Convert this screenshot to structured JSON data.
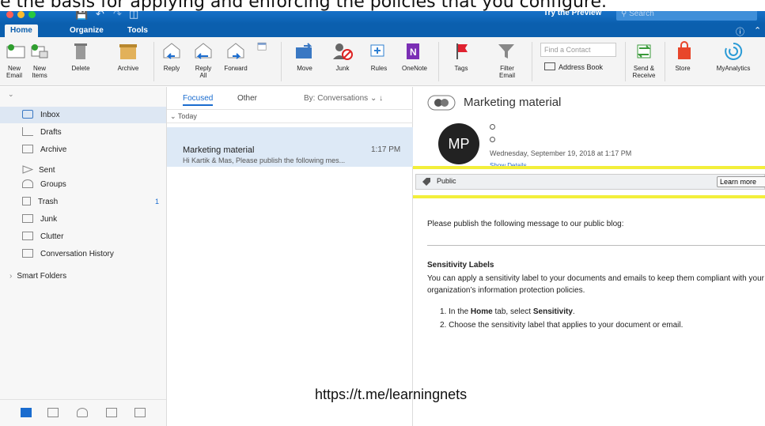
{
  "caption": "e the basis for applying and enforcing the policies that you configure.",
  "titlebar": {
    "try_preview": "Try the Preview",
    "search_placeholder": "Search",
    "help": "?"
  },
  "tabs": [
    "Home",
    "Organize",
    "Tools"
  ],
  "ribbon": {
    "new_email": "New Email",
    "new_items": "New Items",
    "delete": "Delete",
    "archive": "Archive",
    "reply": "Reply",
    "reply_all": "Reply All",
    "forward": "Forward",
    "move": "Move",
    "junk": "Junk",
    "rules": "Rules",
    "onenote": "OneNote",
    "tags": "Tags",
    "filter_email": "Filter Email",
    "find_contact": "Find a Contact",
    "address_book": "Address Book",
    "send_receive": "Send & Receive",
    "store": "Store",
    "myanalytics": "MyAnalytics"
  },
  "sidebar": {
    "folders": [
      {
        "label": "Inbox",
        "icon": "inbox-icon"
      },
      {
        "label": "Drafts",
        "icon": "drafts-icon"
      },
      {
        "label": "Archive",
        "icon": "archive-icon"
      },
      {
        "label": "Sent",
        "icon": "sent-icon"
      },
      {
        "label": "Groups",
        "icon": "groups-icon"
      },
      {
        "label": "Trash",
        "icon": "trash-icon",
        "count": "1"
      },
      {
        "label": "Junk",
        "icon": "junk-icon"
      },
      {
        "label": "Clutter",
        "icon": "folder-icon"
      },
      {
        "label": "Conversation History",
        "icon": "folder-icon"
      }
    ],
    "smart_folders": "Smart Folders"
  },
  "list": {
    "focused": "Focused",
    "other": "Other",
    "sort": "By: Conversations",
    "group": "Today",
    "message": {
      "sender": "Marketing material",
      "time": "1:17 PM",
      "preview": "Hi Kartik & Mas, Please publish the following mes..."
    }
  },
  "reading": {
    "subject": "Marketing material",
    "avatar_initials": "MP",
    "date": "Wednesday, September 19, 2018 at 1:17 PM",
    "show_details": "Show Details",
    "label": "Public",
    "learn_more": "Learn more",
    "body_intro": "Please publish the following message to our public blog:",
    "section_title": "Sensitivity Labels",
    "section_text": "You can apply a sensitivity label to your documents and emails to keep them compliant with your organization’s information protection policies.",
    "step1_pre": "1.  In the ",
    "step1_b1": "Home",
    "step1_mid": " tab, select ",
    "step1_b2": "Sensitivity",
    "step1_end": ".",
    "step2": "2.  Choose the sensitivity label that applies to your document or email."
  },
  "watermark": "https://t.me/learningnets",
  "colors": {
    "accent": "#0b5fae",
    "highlight": "#f3ef3a",
    "selection": "#dde9f6"
  }
}
